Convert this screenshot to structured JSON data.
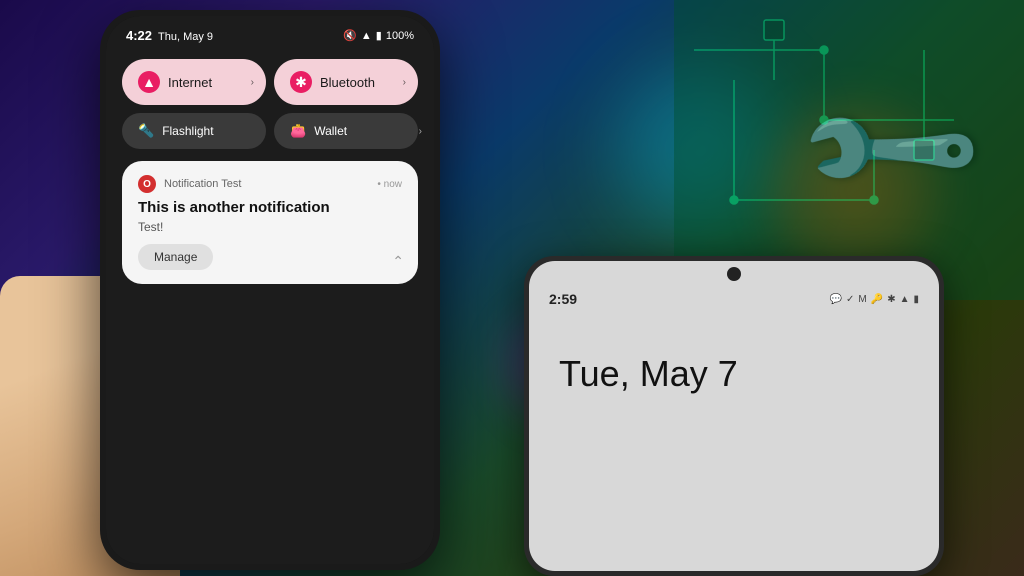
{
  "background": {
    "description": "colorful blurred bokeh tech background with circuit board"
  },
  "phone_main": {
    "status_bar": {
      "time": "4:22",
      "date": "Thu, May 9",
      "icons": {
        "mute": "🔇",
        "wifi": "▲",
        "battery": "100%"
      }
    },
    "quick_settings": {
      "tiles": [
        {
          "id": "internet",
          "label": "Internet",
          "icon": "wifi",
          "active": true,
          "has_chevron": true
        },
        {
          "id": "bluetooth",
          "label": "Bluetooth",
          "icon": "bluetooth",
          "active": true,
          "has_chevron": true
        },
        {
          "id": "flashlight",
          "label": "Flashlight",
          "icon": "flashlight",
          "active": false,
          "has_chevron": false
        },
        {
          "id": "wallet",
          "label": "Wallet",
          "icon": "wallet",
          "active": false,
          "has_chevron": true
        }
      ]
    },
    "notification": {
      "app_name": "Notification Test",
      "time": "now",
      "title": "This is another notification",
      "body": "Test!",
      "manage_label": "Manage",
      "icon": "O"
    }
  },
  "phone_second": {
    "status_bar": {
      "time": "2:59",
      "icons": [
        "messenger",
        "check-circle",
        "gmail",
        "key",
        "bluetooth",
        "wifi",
        "battery"
      ]
    },
    "lock_screen": {
      "date": "Tue, May 7"
    }
  },
  "wrench": {
    "unicode": "🔧"
  }
}
